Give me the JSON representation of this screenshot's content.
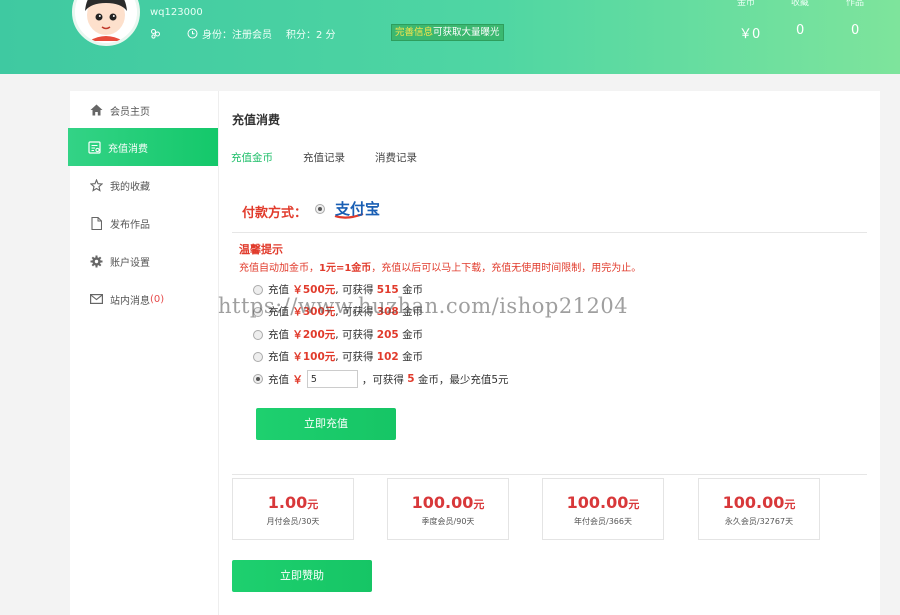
{
  "user": {
    "username": "wq123000",
    "identity_label": "身份：注册会员",
    "points_label": "积分：2 分"
  },
  "promo": {
    "highlight": "完善信息",
    "text": "可获取大量曝光"
  },
  "stats": [
    {
      "label": "金币",
      "value": "￥0"
    },
    {
      "label": "收藏",
      "value": "0"
    },
    {
      "label": "作品",
      "value": "0"
    }
  ],
  "sidebar": {
    "items": [
      {
        "label": "会员主页",
        "icon": "home-icon"
      },
      {
        "label": "充值消费",
        "icon": "recharge-icon",
        "active": true
      },
      {
        "label": "我的收藏",
        "icon": "star-icon"
      },
      {
        "label": "发布作品",
        "icon": "file-icon"
      },
      {
        "label": "账户设置",
        "icon": "gear-icon"
      },
      {
        "label": "站内消息",
        "count": "(0)",
        "icon": "mail-icon"
      }
    ]
  },
  "main": {
    "title": "充值消费",
    "tabs": [
      "充值金币",
      "充值记录",
      "消费记录"
    ],
    "payment_label": "付款方式：",
    "payment_method": "支付宝",
    "tips_title": "温馨提示",
    "tips_prefix": "充值自动加金币，",
    "tips_rate": "1元=1金币",
    "tips_suffix": "，充值以后可以马上下载，充值无使用时间限制，用完为止。",
    "options": [
      {
        "prefix": "充值",
        "amount": "￥500元",
        "mid": ", 可获得",
        "coins": "515",
        "unit": "金币"
      },
      {
        "prefix": "充值",
        "amount": "￥300元",
        "mid": ", 可获得",
        "coins": "308",
        "unit": "金币"
      },
      {
        "prefix": "充值",
        "amount": "￥200元",
        "mid": ", 可获得",
        "coins": "205",
        "unit": "金币"
      },
      {
        "prefix": "充值",
        "amount": "￥100元",
        "mid": ", 可获得",
        "coins": "102",
        "unit": "金币"
      }
    ],
    "custom_option": {
      "prefix": "充值",
      "currency": "￥",
      "input_value": "5",
      "mid": "，可获得",
      "coins": "5",
      "suffix": "金币，最少充值5元"
    },
    "recharge_button": "立即充值",
    "plans": [
      {
        "price": "1.00",
        "unit": "元",
        "desc": "月付会员/30天"
      },
      {
        "price": "100.00",
        "unit": "元",
        "desc": "季度会员/90天"
      },
      {
        "price": "100.00",
        "unit": "元",
        "desc": "年付会员/366天"
      },
      {
        "price": "100.00",
        "unit": "元",
        "desc": "永久会员/32767天"
      }
    ],
    "sponsor_button": "立即赞助"
  },
  "watermark": "https://www.huzhan.com/ishop21204"
}
